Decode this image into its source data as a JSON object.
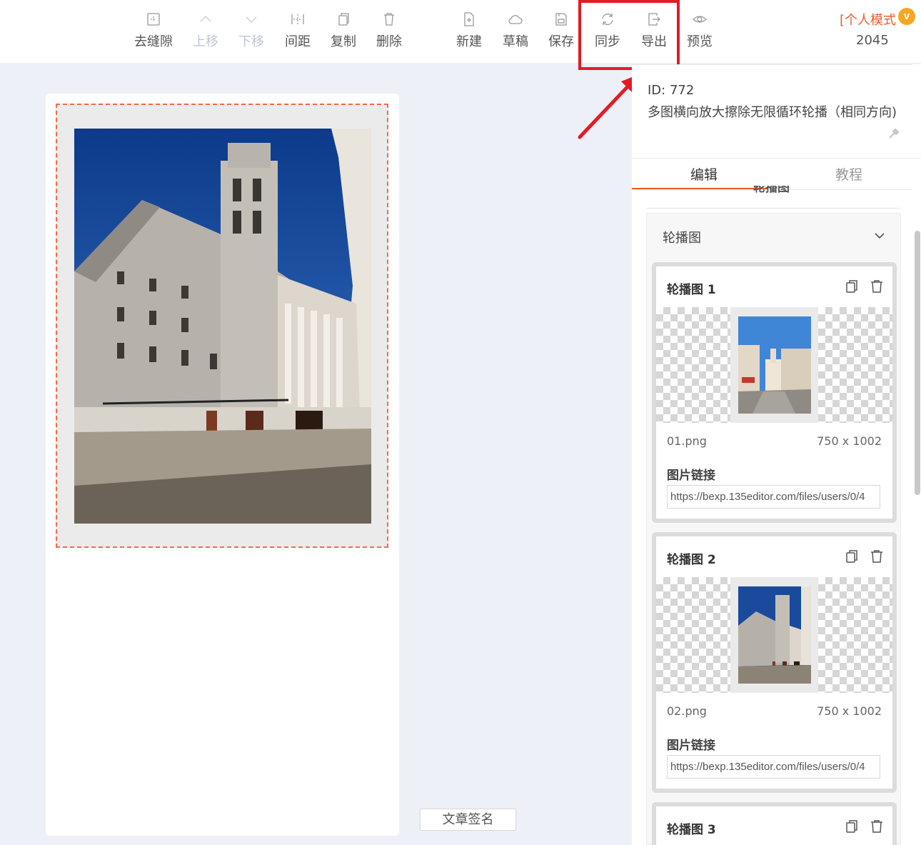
{
  "toolbar": {
    "buttons": [
      {
        "label": "去缝隙",
        "icon": "remove-gap-icon"
      },
      {
        "label": "上移",
        "icon": "chevron-up-icon"
      },
      {
        "label": "下移",
        "icon": "chevron-down-icon"
      },
      {
        "label": "间距",
        "icon": "spacing-icon"
      },
      {
        "label": "复制",
        "icon": "copy-icon"
      },
      {
        "label": "删除",
        "icon": "trash-icon"
      },
      {
        "label": "新建",
        "icon": "new-file-icon"
      },
      {
        "label": "草稿",
        "icon": "cloud-icon"
      },
      {
        "label": "保存",
        "icon": "save-icon"
      },
      {
        "label": "同步",
        "icon": "sync-icon"
      },
      {
        "label": "导出",
        "icon": "export-icon"
      },
      {
        "label": "预览",
        "icon": "eye-icon"
      }
    ],
    "mode_label": "[个人模式",
    "vip_badge": "v",
    "mode_number": "2045"
  },
  "canvas": {
    "signature_button": "文章签名"
  },
  "panel": {
    "id_text": "ID: 772",
    "title": "多图横向放大擦除无限循环轮播（相同方向)",
    "tabs": {
      "edit": "编辑",
      "tutorial": "教程"
    },
    "section_peek": "轮播图",
    "accordion_title": "轮播图",
    "items": [
      {
        "title": "轮播图 1",
        "file_name": "01.png",
        "size": "750 x 1002",
        "link_label": "图片链接",
        "link_value": "https://bexp.135editor.com/files/users/0/4"
      },
      {
        "title": "轮播图 2",
        "file_name": "02.png",
        "size": "750 x 1002",
        "link_label": "图片链接",
        "link_value": "https://bexp.135editor.com/files/users/0/4"
      },
      {
        "title": "轮播图 3"
      }
    ]
  },
  "colors": {
    "accent": "#f05a28",
    "highlight": "#e21c23",
    "vip": "#f5a623"
  }
}
